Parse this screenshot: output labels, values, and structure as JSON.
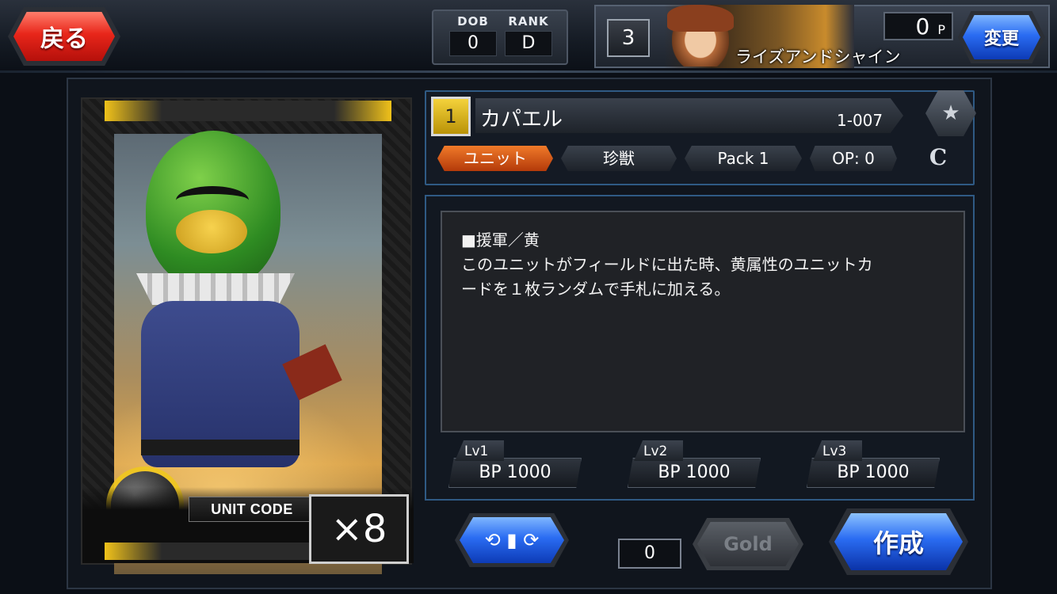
{
  "nav": {
    "back_label": "戻る"
  },
  "status": {
    "dob_label": "DOB",
    "dob_value": "0",
    "rank_label": "RANK",
    "rank_value": "D"
  },
  "player": {
    "level": "3",
    "name": "ライズアンドシャイン",
    "points": "0",
    "points_unit": "P",
    "change_label": "変更"
  },
  "card": {
    "cost": "1",
    "name": "カパエル",
    "number": "1-007",
    "type": "ユニット",
    "race": "珍獣",
    "pack": "Pack 1",
    "op": "OP: 0",
    "rarity": "C",
    "unit_code_label": "UNIT CODE",
    "owned_count": "×8",
    "ability_lines": [
      "■援軍／黄",
      "このユニットがフィールドに出た時、黄属性のユニットカ",
      "ードを１枚ランダムで手札に加える。"
    ],
    "bp": [
      {
        "level": "Lv1",
        "value": "BP 1000"
      },
      {
        "level": "Lv2",
        "value": "BP 1000"
      },
      {
        "level": "Lv3",
        "value": "BP 1000"
      }
    ]
  },
  "actions": {
    "gold_count": "0",
    "gold_label": "Gold",
    "create_label": "作成"
  },
  "icons": {
    "favorite": "star-icon",
    "swap": "swap-card-icon"
  },
  "colors": {
    "back_button": "#e8261a",
    "primary_button": "#2a6cf2",
    "type_tag": "#f07a2a",
    "cost_badge": "#f4d23b",
    "panel_border": "#2f5a84"
  }
}
